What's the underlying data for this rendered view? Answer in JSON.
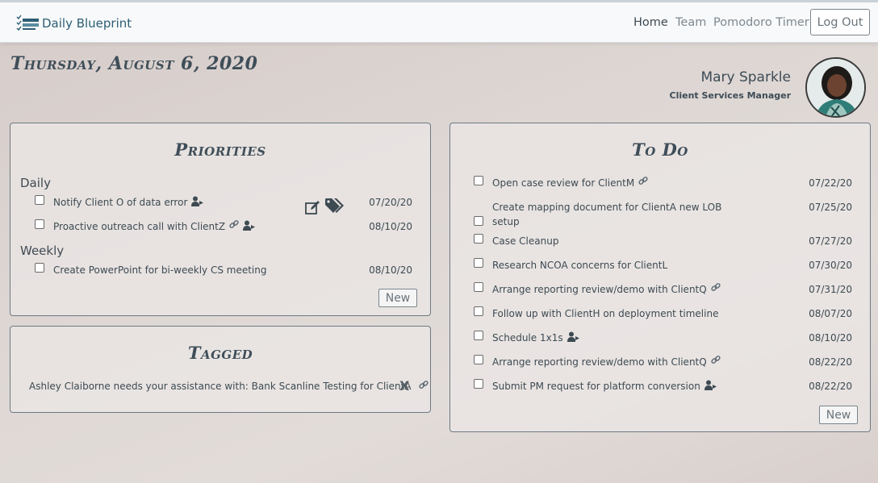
{
  "nav": {
    "brand": "Daily Blueprint",
    "links": [
      "Home",
      "Team",
      "Pomodoro Timer"
    ],
    "logout": "Log Out"
  },
  "header": {
    "date": "Thursday, August 6, 2020",
    "user_name": "Mary Sparkle",
    "user_title": "Client Services Manager"
  },
  "priorities": {
    "title": "Priorities",
    "daily_label": "Daily",
    "weekly_label": "Weekly",
    "daily": [
      {
        "text": "Notify Client O of data error",
        "date": "07/20/20",
        "icons": [
          "user-share-icon"
        ]
      },
      {
        "text": "Proactive outreach call with ClientZ",
        "date": "08/10/20",
        "icons": [
          "link-icon",
          "user-share-icon"
        ]
      }
    ],
    "weekly": [
      {
        "text": "Create PowerPoint for bi-weekly CS meeting",
        "date": "08/10/20",
        "icons": []
      }
    ],
    "new_label": "New"
  },
  "tagged": {
    "title": "Tagged",
    "item": "Ashley Claiborne needs your assistance with: Bank Scanline Testing for ClientA",
    "dismiss": "X"
  },
  "todo": {
    "title": "To Do",
    "items": [
      {
        "text": "Open case review for ClientM",
        "date": "07/22/20",
        "icons": [
          "link-icon"
        ]
      },
      {
        "text": "Create mapping document for ClientA new LOB",
        "text2": "setup",
        "date": "07/25/20",
        "icons": []
      },
      {
        "text": "Case Cleanup",
        "date": "07/27/20",
        "icons": []
      },
      {
        "text": "Research NCOA concerns for ClientL",
        "date": "07/30/20",
        "icons": []
      },
      {
        "text": "Arrange reporting review/demo with ClientQ",
        "date": "07/31/20",
        "icons": [
          "link-icon"
        ]
      },
      {
        "text": "Follow up with ClientH on deployment timeline",
        "date": "08/07/20",
        "icons": []
      },
      {
        "text": "Schedule 1x1s",
        "date": "08/10/20",
        "icons": [
          "user-share-icon"
        ]
      },
      {
        "text": "Arrange reporting review/demo with ClientQ",
        "date": "08/22/20",
        "icons": [
          "link-icon"
        ]
      },
      {
        "text": "Submit PM request for platform conversion",
        "date": "08/22/20",
        "icons": [
          "user-share-icon"
        ]
      }
    ],
    "new_label": "New"
  },
  "colors": {
    "brand": "#2c5f74",
    "heading": "#3f4e59",
    "border": "#6e7a83"
  }
}
